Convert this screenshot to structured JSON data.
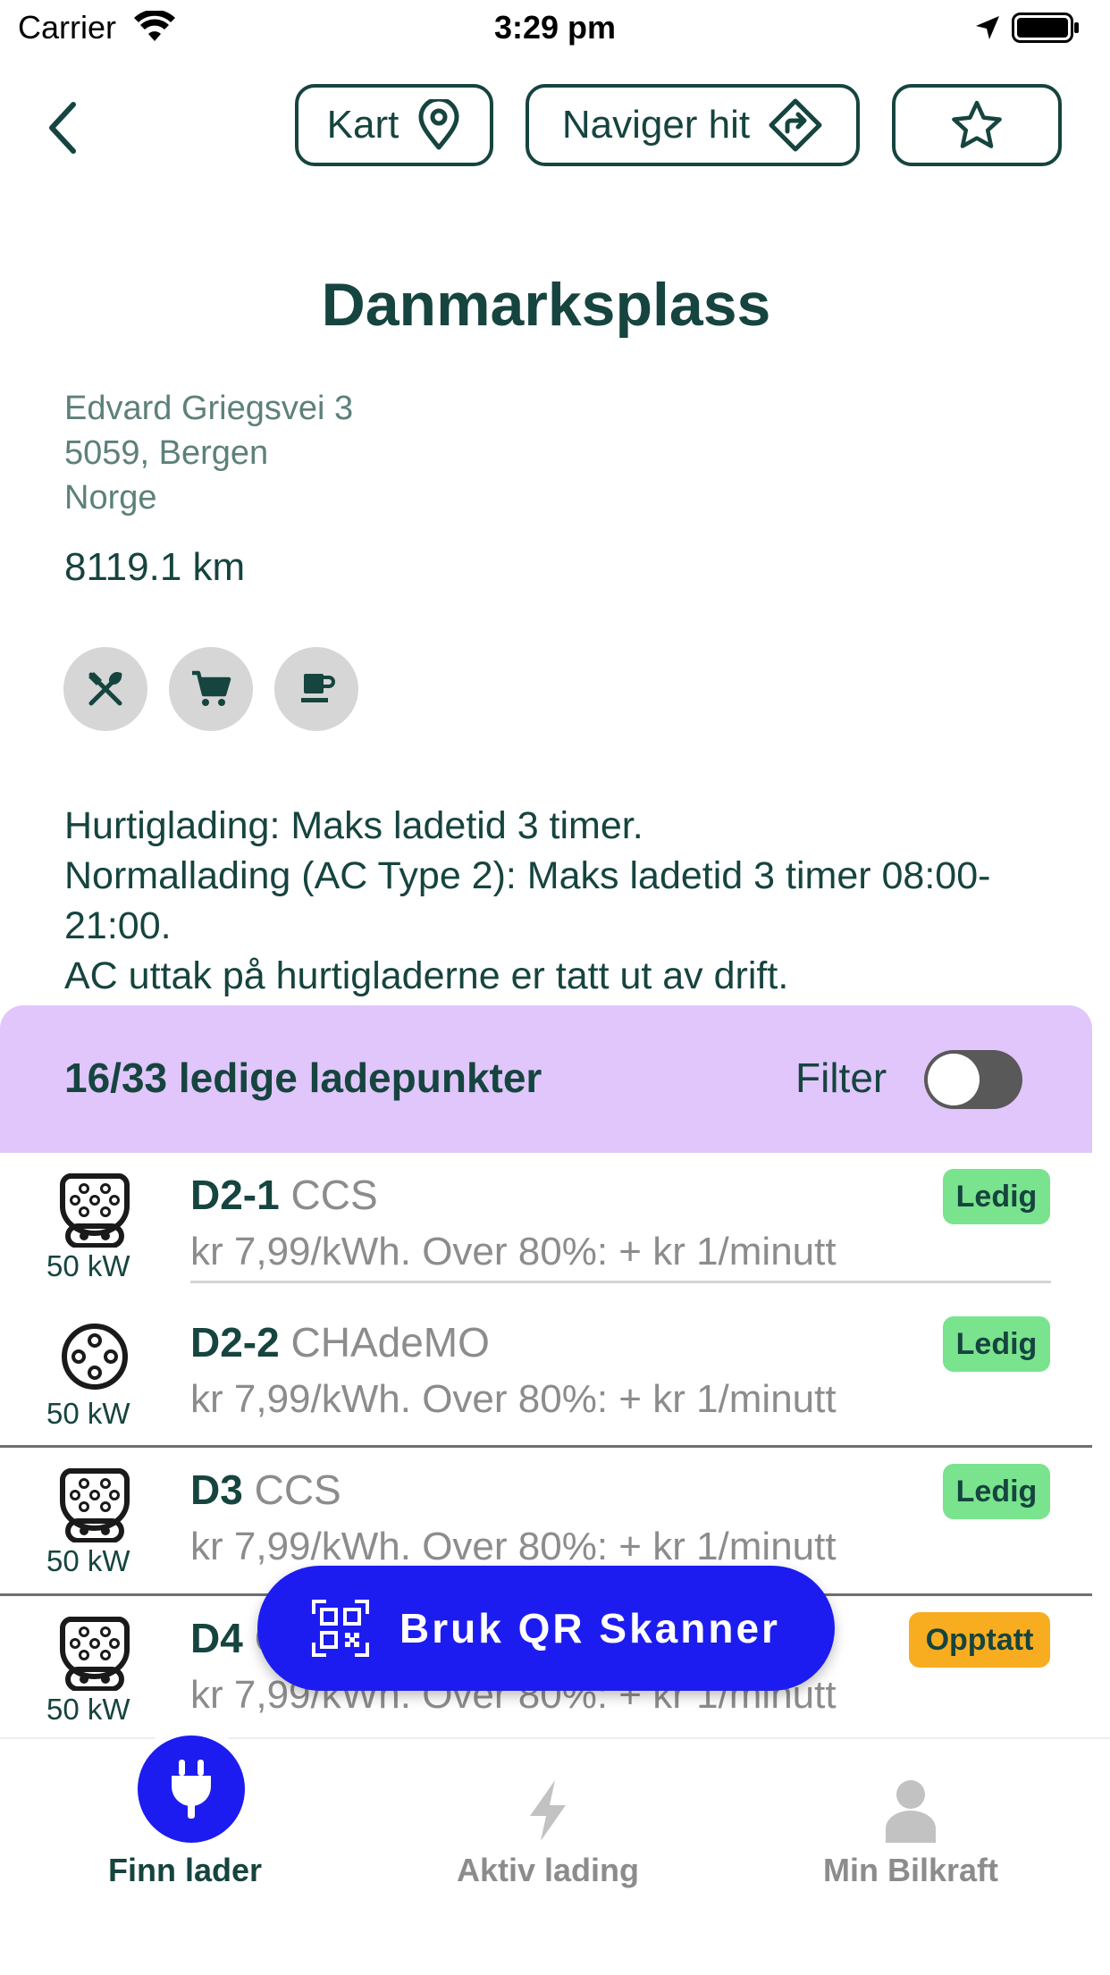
{
  "status_bar": {
    "carrier": "Carrier",
    "time": "3:29 pm"
  },
  "header": {
    "map_label": "Kart",
    "navigate_label": "Naviger hit"
  },
  "station": {
    "title": "Danmarksplass",
    "address_line1": "Edvard Griegsvei 3",
    "address_line2": "5059, Bergen",
    "address_line3": "Norge",
    "distance": "8119.1 km",
    "amenities": [
      "restaurant-icon",
      "shopping-cart-icon",
      "coffee-icon"
    ],
    "description": [
      "Hurtiglading: Maks ladetid 3 timer.",
      "Normallading (AC Type 2): Maks ladetid 3 timer 08:00-21:00.",
      "AC uttak på hurtigladerne er tatt ut av drift."
    ]
  },
  "availability": {
    "count_text": "16/33 ledige ladepunkter",
    "filter_label": "Filter",
    "filter_on": false
  },
  "connectors": [
    {
      "id": "D2-1",
      "type": "CCS",
      "power": "50 kW",
      "price": "kr 7,99/kWh. Over 80%: + kr 1/minutt",
      "status": "Ledig"
    },
    {
      "id": "D2-2",
      "type": "CHAdeMO",
      "power": "50 kW",
      "price": "kr 7,99/kWh. Over 80%: + kr 1/minutt",
      "status": "Ledig"
    },
    {
      "id": "D3",
      "type": "CCS",
      "power": "50 kW",
      "price": "kr 7,99/kWh. Over 80%: + kr 1/minutt",
      "status": "Ledig"
    },
    {
      "id": "D4",
      "type": "CCS",
      "power": "50 kW",
      "price": "kr 7,99/kWh. Over 80%: + kr 1/minutt",
      "status": "Opptatt"
    }
  ],
  "qr_button": {
    "label": "Bruk QR Skanner"
  },
  "tabs": [
    {
      "label": "Finn lader",
      "icon": "plug-icon",
      "active": true
    },
    {
      "label": "Aktiv lading",
      "icon": "lightning-icon",
      "active": false
    },
    {
      "label": "Min Bilkraft",
      "icon": "person-icon",
      "active": false
    }
  ],
  "colors": {
    "primary_text": "#16443f",
    "accent_blue": "#1d1cf0",
    "availability_bg": "#e0c6fb",
    "status_available": "#79e38d",
    "status_busy": "#f7ad1f"
  }
}
